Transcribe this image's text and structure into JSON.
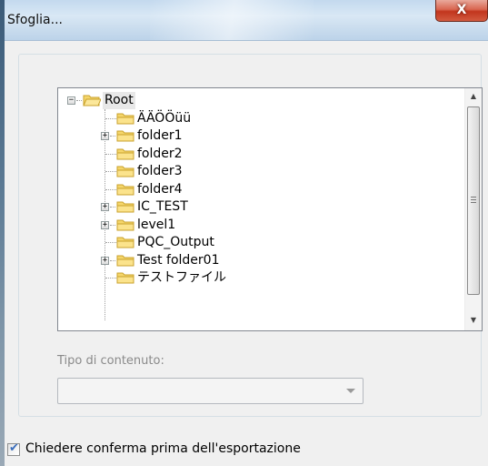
{
  "window": {
    "title": "Sfoglia...",
    "close_glyph": "X"
  },
  "tree": {
    "root": {
      "label": "Root",
      "expanded": true,
      "icon": "folder-open-icon"
    },
    "items": [
      {
        "label": "ÄÄÖÖüü",
        "has_children": false
      },
      {
        "label": "folder1",
        "has_children": true
      },
      {
        "label": "folder2",
        "has_children": false
      },
      {
        "label": "folder3",
        "has_children": false
      },
      {
        "label": "folder4",
        "has_children": false
      },
      {
        "label": "IC_TEST",
        "has_children": true
      },
      {
        "label": "level1",
        "has_children": true
      },
      {
        "label": "PQC_Output",
        "has_children": false
      },
      {
        "label": "Test folder01",
        "has_children": true
      },
      {
        "label": "テストファイル",
        "has_children": false
      }
    ],
    "expander_collapsed": "+",
    "expander_expanded": "−"
  },
  "content_type": {
    "label": "Tipo di contenuto:",
    "value": ""
  },
  "confirm_export": {
    "label": "Chiedere conferma prima dell'esportazione",
    "checked": true
  },
  "colors": {
    "folder_fill": "#f5d66b",
    "folder_edge": "#c9a22c",
    "close_button": "#c7452a",
    "titlebar": "#cfe0f0"
  }
}
